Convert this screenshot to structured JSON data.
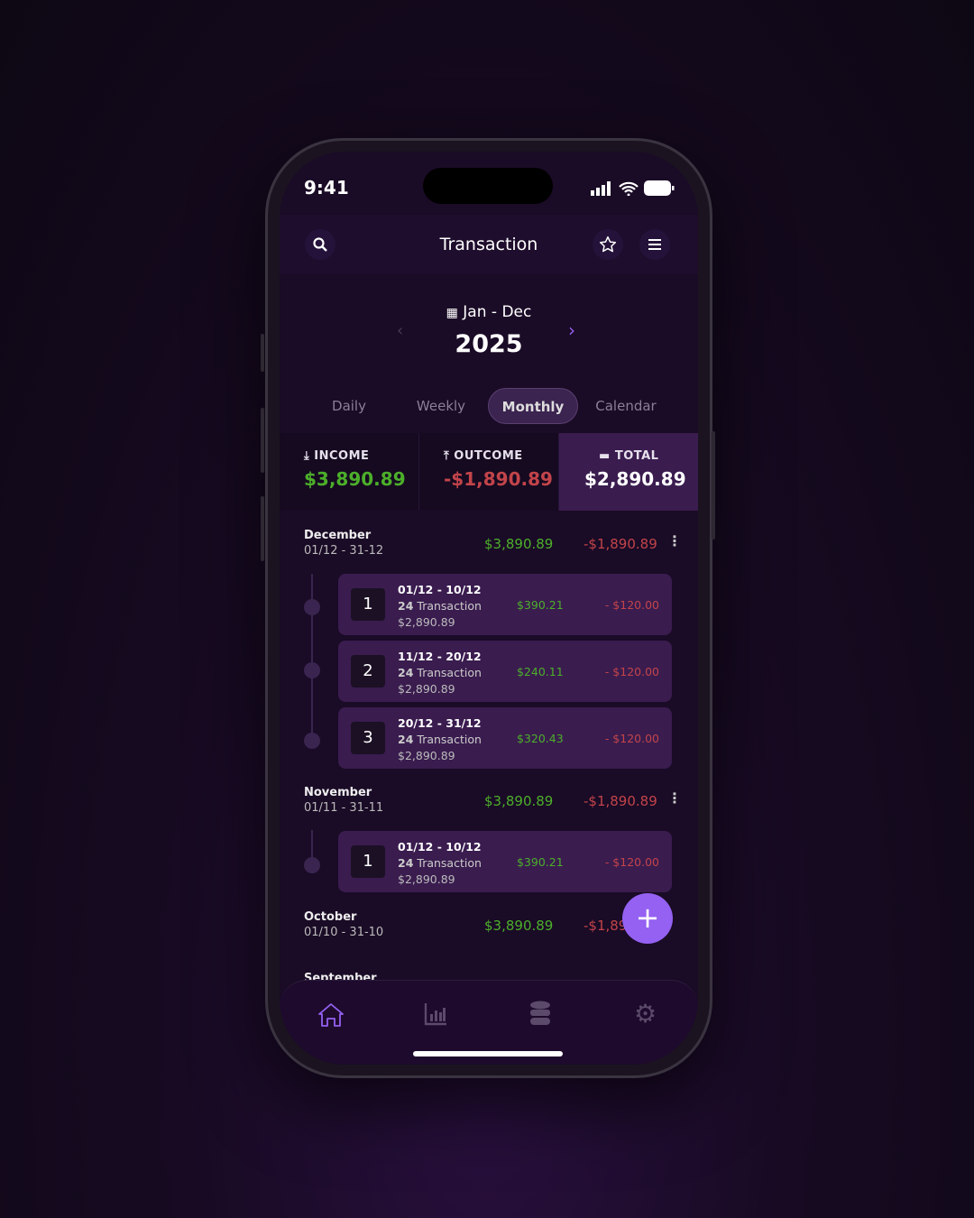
{
  "status": {
    "time": "9:41"
  },
  "header": {
    "title": "Transaction"
  },
  "period": {
    "range": "Jan - Dec",
    "year": "2025"
  },
  "tabs": [
    {
      "label": "Daily"
    },
    {
      "label": "Weekly"
    },
    {
      "label": "Monthly",
      "active": true
    },
    {
      "label": "Calendar"
    }
  ],
  "summary": {
    "income": {
      "label": "INCOME",
      "value": "$3,890.89"
    },
    "outcome": {
      "label": "OUTCOME",
      "value": "-$1,890.89"
    },
    "total": {
      "label": "TOTAL",
      "value": "$2,890.89"
    }
  },
  "months": [
    {
      "name": "December",
      "range": "01/12 - 31-12",
      "income": "$3,890.89",
      "outcome": "-$1,890.89",
      "weeks": [
        {
          "num": "1",
          "range": "01/12 - 10/12",
          "count": "24",
          "count_label": "Transaction",
          "total": "$2,890.89",
          "income": "$390.21",
          "outcome": "- $120.00"
        },
        {
          "num": "2",
          "range": "11/12 - 20/12",
          "count": "24",
          "count_label": "Transaction",
          "total": "$2,890.89",
          "income": "$240.11",
          "outcome": "- $120.00"
        },
        {
          "num": "3",
          "range": "20/12 - 31/12",
          "count": "24",
          "count_label": "Transaction",
          "total": "$2,890.89",
          "income": "$320.43",
          "outcome": "- $120.00"
        }
      ]
    },
    {
      "name": "November",
      "range": "01/11 - 31-11",
      "income": "$3,890.89",
      "outcome": "-$1,890.89",
      "weeks": [
        {
          "num": "1",
          "range": "01/12 - 10/12",
          "count": "24",
          "count_label": "Transaction",
          "total": "$2,890.89",
          "income": "$390.21",
          "outcome": "- $120.00"
        }
      ]
    },
    {
      "name": "October",
      "range": "01/10 - 31-10",
      "income": "$3,890.89",
      "outcome": "-$1,890.89"
    },
    {
      "name": "September"
    }
  ],
  "colors": {
    "accent": "#9461f2",
    "income": "#4caf2a",
    "outcome": "#c2444a",
    "background": "#1a0b26"
  },
  "icons": {
    "search": "search-icon",
    "favorite": "star-icon",
    "menu": "menu-icon",
    "nav": [
      "home-icon",
      "chart-icon",
      "database-icon",
      "gear-icon"
    ]
  }
}
